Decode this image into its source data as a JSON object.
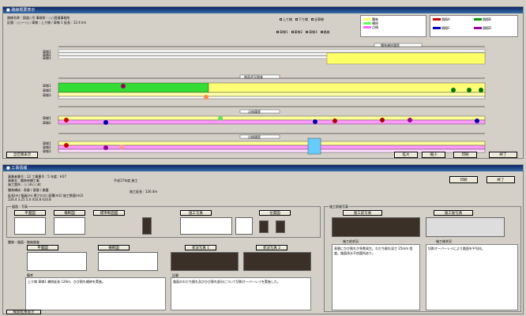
{
  "top": {
    "title": "■ 路線概要表示",
    "info_line1": "路線名称 : 国道○号    事務所 : ○○国道事務所",
    "info_line2": "区間 : ○○〜○○    車線 : 上り線 / 車線 1    延長 : 12.4 km",
    "radio1": [
      "上り線",
      "下り線",
      "全車線"
    ],
    "radio2": [
      "車線1",
      "車線2",
      "車線3",
      "路肩"
    ],
    "legend1": [
      {
        "label": "舗装",
        "color": "#ffff66"
      },
      {
        "label": "補修",
        "color": "#66ff66"
      },
      {
        "label": "点検",
        "color": "#ff66ff"
      }
    ],
    "legend2": [
      {
        "label": "損傷A",
        "color": "#cc0000"
      },
      {
        "label": "損傷B",
        "color": "#009900"
      },
      {
        "label": "損傷C",
        "color": "#0000cc"
      },
      {
        "label": "損傷D",
        "color": "#990099"
      }
    ],
    "tracks": [
      {
        "title": "舗装補修履歴",
        "rows": [
          "車線1",
          "車線2",
          "車線3"
        ]
      },
      {
        "title": "路面状況調査",
        "rows": [
          "車線1",
          "車線2",
          "車線3"
        ]
      },
      {
        "title": "点検履歴",
        "rows": [
          "車線1",
          "車線2"
        ]
      },
      {
        "title": "点検履歴",
        "rows": [
          "車線1",
          "車線2",
          "車線3"
        ]
      }
    ],
    "buttons": {
      "left": "全区間表示",
      "b1": "拡大",
      "b2": "縮小",
      "b3": "印刷",
      "b4": "終了"
    }
  },
  "bottom": {
    "title": "■ 工事情報",
    "fields": [
      "事業者番号 : 12   工事番号 : 5   年度 : H17",
      "事業名 : 舗装修繕工事",
      "施工箇所 : ○○市○○町",
      "舗装構成 : 表層 / 基層 / 路盤",
      "延長(m)   幅員(m)   厚さ(cm)   面積(m2)   施工数量(m2)",
      "126.4   3.25   5.0   410.8   410.8"
    ],
    "header_right": "施工延長 : 126.4m",
    "header_sub": "平成17年度 施工",
    "buttons": {
      "print": "印刷",
      "close": "終了"
    },
    "figures_label": "図面・写真",
    "figures": [
      "平面図",
      "横断図",
      "標準断面図",
      "施工写真",
      "位置図"
    ],
    "mid_label": "舗装・路面・路肩調査",
    "mid_figs": [
      "平面図",
      "横断図",
      "状況写真 1",
      "状況写真 2"
    ],
    "memo_label": "備考",
    "memo_text": "上り線 車線1 補修延長 126m、ひび割れ補修を実施。",
    "memo2_label": "記事",
    "memo2_text": "路面のわだち掘れ及びひび割れ部分について切削オーバーレイを実施した。",
    "right_label": "施工前後写真",
    "right_photos": [
      "施工前写真",
      "施工後写真"
    ],
    "note1_label": "施工前状況",
    "note1_text": "表層にひび割れが多数発生。わだち掘れ深さ 25mm 程度。路面排水不良箇所あり。",
    "note2_label": "施工後状況",
    "note2_text": "切削オーバーレイにより路面を平坦化。",
    "status": "検索結果表示"
  }
}
